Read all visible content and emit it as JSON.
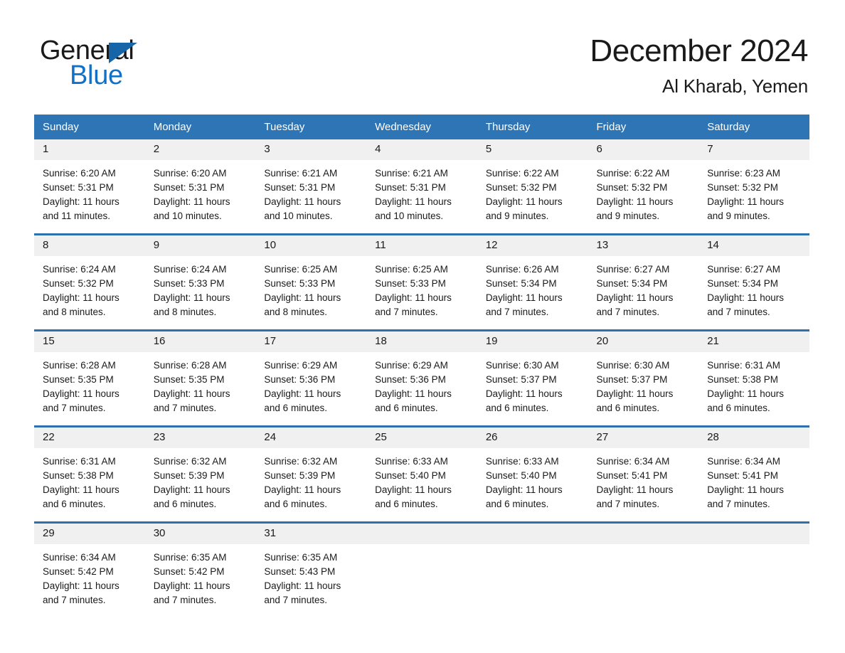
{
  "brand": {
    "name_part1": "General",
    "name_part2": "Blue",
    "triangle_color": "#1565a8",
    "blue_color": "#1271c6"
  },
  "header": {
    "title": "December 2024",
    "subtitle": "Al Kharab, Yemen"
  },
  "theme": {
    "header_row_bg": "#2e75b6",
    "row_divider": "#2e6fad",
    "daynum_bg": "#f0f0f0",
    "text": "#1a1a1a"
  },
  "weekday_headers": [
    "Sunday",
    "Monday",
    "Tuesday",
    "Wednesday",
    "Thursday",
    "Friday",
    "Saturday"
  ],
  "weeks": [
    [
      {
        "day": "1",
        "sunrise": "Sunrise: 6:20 AM",
        "sunset": "Sunset: 5:31 PM",
        "daylight_1": "Daylight: 11 hours",
        "daylight_2": "and 11 minutes."
      },
      {
        "day": "2",
        "sunrise": "Sunrise: 6:20 AM",
        "sunset": "Sunset: 5:31 PM",
        "daylight_1": "Daylight: 11 hours",
        "daylight_2": "and 10 minutes."
      },
      {
        "day": "3",
        "sunrise": "Sunrise: 6:21 AM",
        "sunset": "Sunset: 5:31 PM",
        "daylight_1": "Daylight: 11 hours",
        "daylight_2": "and 10 minutes."
      },
      {
        "day": "4",
        "sunrise": "Sunrise: 6:21 AM",
        "sunset": "Sunset: 5:31 PM",
        "daylight_1": "Daylight: 11 hours",
        "daylight_2": "and 10 minutes."
      },
      {
        "day": "5",
        "sunrise": "Sunrise: 6:22 AM",
        "sunset": "Sunset: 5:32 PM",
        "daylight_1": "Daylight: 11 hours",
        "daylight_2": "and 9 minutes."
      },
      {
        "day": "6",
        "sunrise": "Sunrise: 6:22 AM",
        "sunset": "Sunset: 5:32 PM",
        "daylight_1": "Daylight: 11 hours",
        "daylight_2": "and 9 minutes."
      },
      {
        "day": "7",
        "sunrise": "Sunrise: 6:23 AM",
        "sunset": "Sunset: 5:32 PM",
        "daylight_1": "Daylight: 11 hours",
        "daylight_2": "and 9 minutes."
      }
    ],
    [
      {
        "day": "8",
        "sunrise": "Sunrise: 6:24 AM",
        "sunset": "Sunset: 5:32 PM",
        "daylight_1": "Daylight: 11 hours",
        "daylight_2": "and 8 minutes."
      },
      {
        "day": "9",
        "sunrise": "Sunrise: 6:24 AM",
        "sunset": "Sunset: 5:33 PM",
        "daylight_1": "Daylight: 11 hours",
        "daylight_2": "and 8 minutes."
      },
      {
        "day": "10",
        "sunrise": "Sunrise: 6:25 AM",
        "sunset": "Sunset: 5:33 PM",
        "daylight_1": "Daylight: 11 hours",
        "daylight_2": "and 8 minutes."
      },
      {
        "day": "11",
        "sunrise": "Sunrise: 6:25 AM",
        "sunset": "Sunset: 5:33 PM",
        "daylight_1": "Daylight: 11 hours",
        "daylight_2": "and 7 minutes."
      },
      {
        "day": "12",
        "sunrise": "Sunrise: 6:26 AM",
        "sunset": "Sunset: 5:34 PM",
        "daylight_1": "Daylight: 11 hours",
        "daylight_2": "and 7 minutes."
      },
      {
        "day": "13",
        "sunrise": "Sunrise: 6:27 AM",
        "sunset": "Sunset: 5:34 PM",
        "daylight_1": "Daylight: 11 hours",
        "daylight_2": "and 7 minutes."
      },
      {
        "day": "14",
        "sunrise": "Sunrise: 6:27 AM",
        "sunset": "Sunset: 5:34 PM",
        "daylight_1": "Daylight: 11 hours",
        "daylight_2": "and 7 minutes."
      }
    ],
    [
      {
        "day": "15",
        "sunrise": "Sunrise: 6:28 AM",
        "sunset": "Sunset: 5:35 PM",
        "daylight_1": "Daylight: 11 hours",
        "daylight_2": "and 7 minutes."
      },
      {
        "day": "16",
        "sunrise": "Sunrise: 6:28 AM",
        "sunset": "Sunset: 5:35 PM",
        "daylight_1": "Daylight: 11 hours",
        "daylight_2": "and 7 minutes."
      },
      {
        "day": "17",
        "sunrise": "Sunrise: 6:29 AM",
        "sunset": "Sunset: 5:36 PM",
        "daylight_1": "Daylight: 11 hours",
        "daylight_2": "and 6 minutes."
      },
      {
        "day": "18",
        "sunrise": "Sunrise: 6:29 AM",
        "sunset": "Sunset: 5:36 PM",
        "daylight_1": "Daylight: 11 hours",
        "daylight_2": "and 6 minutes."
      },
      {
        "day": "19",
        "sunrise": "Sunrise: 6:30 AM",
        "sunset": "Sunset: 5:37 PM",
        "daylight_1": "Daylight: 11 hours",
        "daylight_2": "and 6 minutes."
      },
      {
        "day": "20",
        "sunrise": "Sunrise: 6:30 AM",
        "sunset": "Sunset: 5:37 PM",
        "daylight_1": "Daylight: 11 hours",
        "daylight_2": "and 6 minutes."
      },
      {
        "day": "21",
        "sunrise": "Sunrise: 6:31 AM",
        "sunset": "Sunset: 5:38 PM",
        "daylight_1": "Daylight: 11 hours",
        "daylight_2": "and 6 minutes."
      }
    ],
    [
      {
        "day": "22",
        "sunrise": "Sunrise: 6:31 AM",
        "sunset": "Sunset: 5:38 PM",
        "daylight_1": "Daylight: 11 hours",
        "daylight_2": "and 6 minutes."
      },
      {
        "day": "23",
        "sunrise": "Sunrise: 6:32 AM",
        "sunset": "Sunset: 5:39 PM",
        "daylight_1": "Daylight: 11 hours",
        "daylight_2": "and 6 minutes."
      },
      {
        "day": "24",
        "sunrise": "Sunrise: 6:32 AM",
        "sunset": "Sunset: 5:39 PM",
        "daylight_1": "Daylight: 11 hours",
        "daylight_2": "and 6 minutes."
      },
      {
        "day": "25",
        "sunrise": "Sunrise: 6:33 AM",
        "sunset": "Sunset: 5:40 PM",
        "daylight_1": "Daylight: 11 hours",
        "daylight_2": "and 6 minutes."
      },
      {
        "day": "26",
        "sunrise": "Sunrise: 6:33 AM",
        "sunset": "Sunset: 5:40 PM",
        "daylight_1": "Daylight: 11 hours",
        "daylight_2": "and 6 minutes."
      },
      {
        "day": "27",
        "sunrise": "Sunrise: 6:34 AM",
        "sunset": "Sunset: 5:41 PM",
        "daylight_1": "Daylight: 11 hours",
        "daylight_2": "and 7 minutes."
      },
      {
        "day": "28",
        "sunrise": "Sunrise: 6:34 AM",
        "sunset": "Sunset: 5:41 PM",
        "daylight_1": "Daylight: 11 hours",
        "daylight_2": "and 7 minutes."
      }
    ],
    [
      {
        "day": "29",
        "sunrise": "Sunrise: 6:34 AM",
        "sunset": "Sunset: 5:42 PM",
        "daylight_1": "Daylight: 11 hours",
        "daylight_2": "and 7 minutes."
      },
      {
        "day": "30",
        "sunrise": "Sunrise: 6:35 AM",
        "sunset": "Sunset: 5:42 PM",
        "daylight_1": "Daylight: 11 hours",
        "daylight_2": "and 7 minutes."
      },
      {
        "day": "31",
        "sunrise": "Sunrise: 6:35 AM",
        "sunset": "Sunset: 5:43 PM",
        "daylight_1": "Daylight: 11 hours",
        "daylight_2": "and 7 minutes."
      },
      {
        "day": "",
        "sunrise": "",
        "sunset": "",
        "daylight_1": "",
        "daylight_2": ""
      },
      {
        "day": "",
        "sunrise": "",
        "sunset": "",
        "daylight_1": "",
        "daylight_2": ""
      },
      {
        "day": "",
        "sunrise": "",
        "sunset": "",
        "daylight_1": "",
        "daylight_2": ""
      },
      {
        "day": "",
        "sunrise": "",
        "sunset": "",
        "daylight_1": "",
        "daylight_2": ""
      }
    ]
  ]
}
